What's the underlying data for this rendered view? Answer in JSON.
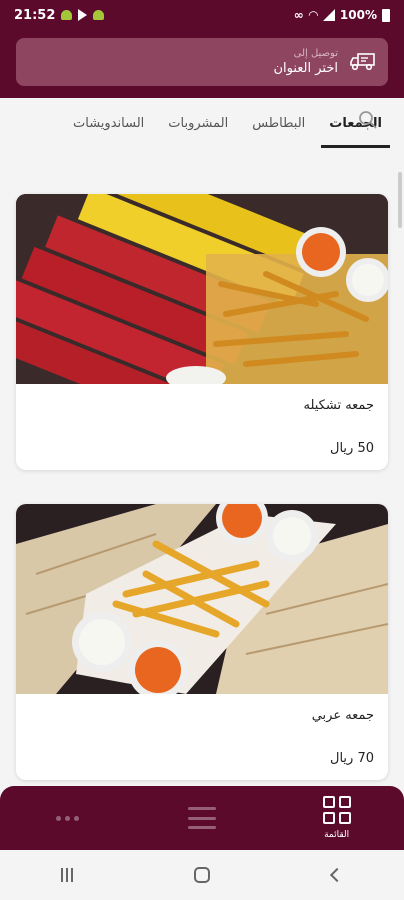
{
  "status_bar": {
    "time": "21:52",
    "battery": "100%"
  },
  "header": {
    "address_label": "توصيل إلى",
    "address_value": "اختر العنوان"
  },
  "tabs": [
    {
      "label": "الجمعات",
      "active": true
    },
    {
      "label": "البطاطس",
      "active": false
    },
    {
      "label": "المشروبات",
      "active": false
    },
    {
      "label": "الساندويشات",
      "active": false
    }
  ],
  "products": [
    {
      "title": "جمعه تشكيله",
      "price": "50 ريال"
    },
    {
      "title": "جمعه عربي",
      "price": "70 ريال"
    }
  ],
  "bottom_nav": [
    {
      "label": "القائمة",
      "icon": "grid-icon",
      "active": true
    },
    {
      "label": "",
      "icon": "list-icon",
      "active": false
    },
    {
      "label": "",
      "icon": "more-dots-icon",
      "active": false
    }
  ],
  "colors": {
    "brand": "#5c0a2c",
    "address_box": "#8e4560"
  }
}
